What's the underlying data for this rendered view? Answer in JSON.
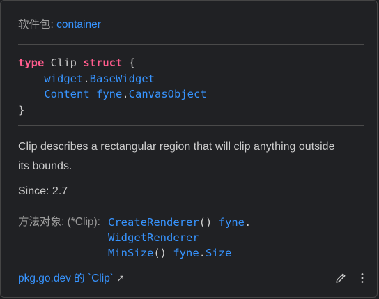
{
  "package": {
    "label": "软件包:",
    "name": "container"
  },
  "code": {
    "kw_type": "type",
    "name": "Clip",
    "kw_struct": "struct",
    "open_brace": "{",
    "close_brace": "}",
    "field1_pkg": "widget",
    "field1_dot": ".",
    "field1_type": "BaseWidget",
    "field2_name": "Content",
    "field2_pkg": "fyne",
    "field2_dot": ".",
    "field2_type": "CanvasObject"
  },
  "description": "Clip describes a rectangular region that will clip anything outside its bounds.",
  "since": "Since: 2.7",
  "methods": {
    "label": "方法对象: (*Clip):",
    "m1_name": "CreateRenderer",
    "m1_parens": "()",
    "m1_pkg": "fyne",
    "m1_dot": ".",
    "m1_type_line2": "WidgetRenderer",
    "m2_name": "MinSize",
    "m2_parens": "()",
    "m2_pkg": "fyne",
    "m2_dot": ".",
    "m2_type": "Size"
  },
  "footer": {
    "link_text": "pkg.go.dev 的 `Clip`",
    "arrow": "↗",
    "icons": [
      "pencil-icon",
      "more-vertical-icon"
    ]
  },
  "colors": {
    "background": "#202124",
    "link": "#3794ff",
    "keyword": "#ff5c8d",
    "text": "#cccccc",
    "muted": "#9d9d9d",
    "divider": "#4a4a4a"
  }
}
